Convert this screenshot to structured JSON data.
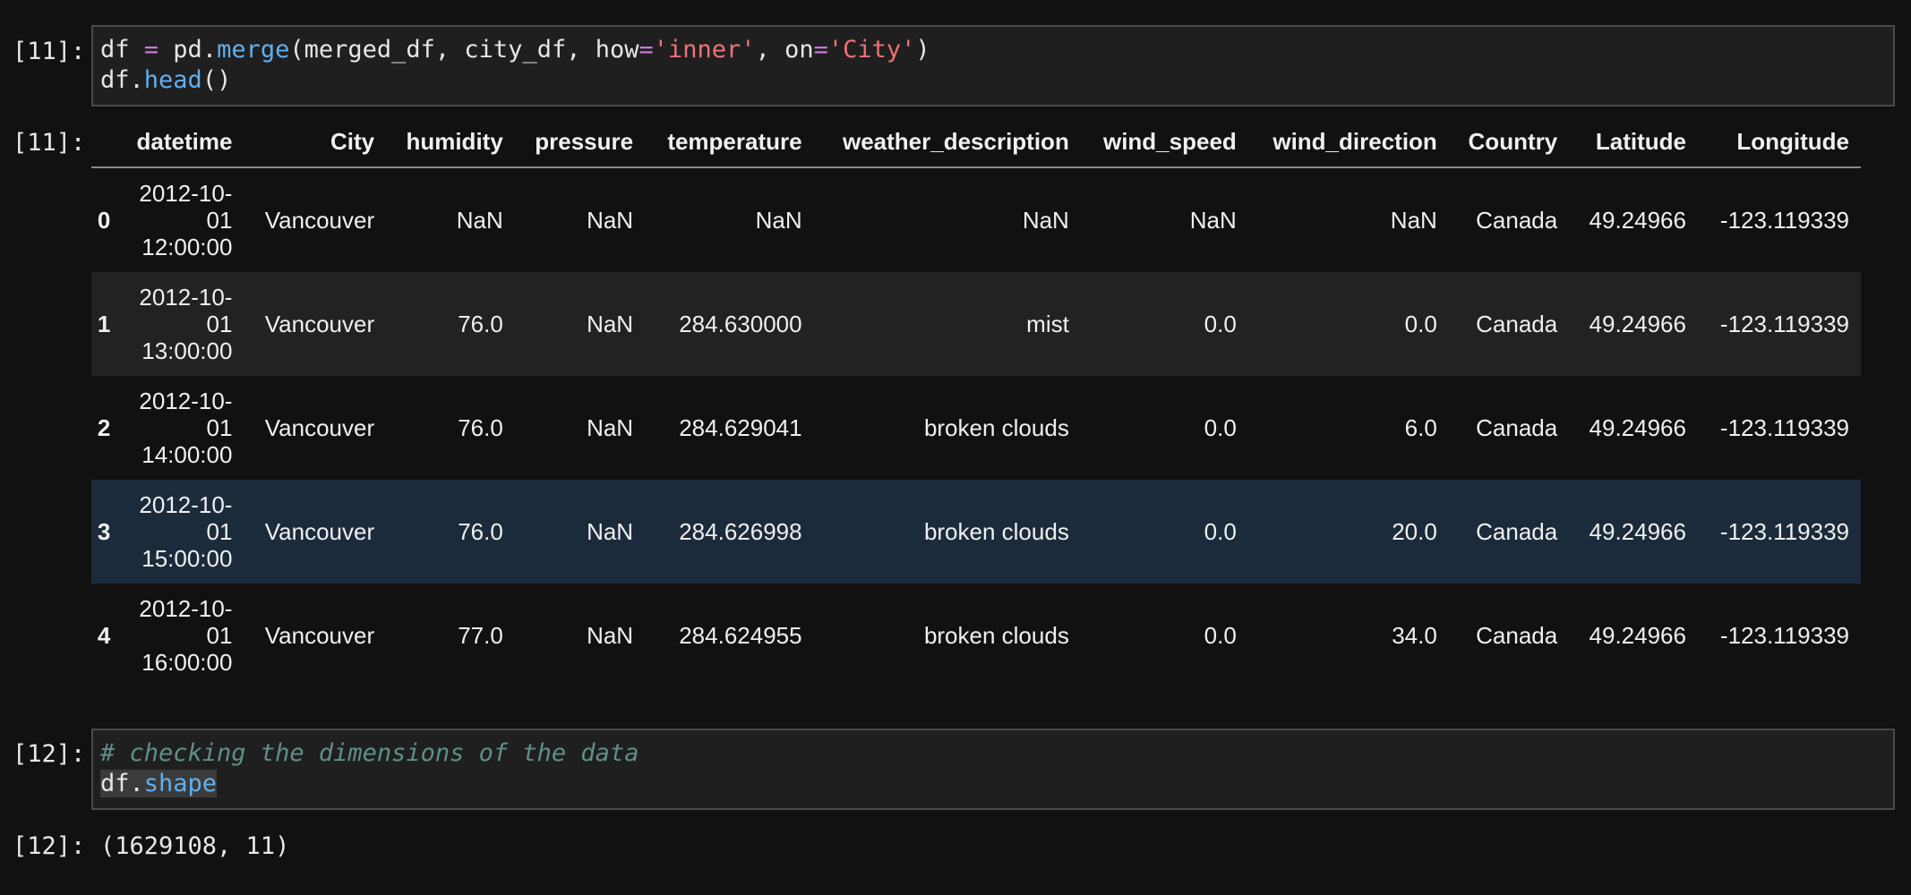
{
  "cell11": {
    "in_prompt": "[11]:",
    "out_prompt": "[11]:",
    "code": {
      "line1": {
        "a": "df ",
        "op1": "=",
        "b": " pd.",
        "fn": "merge",
        "c": "(merged_df, city_df, how",
        "op2": "=",
        "s1": "'inner'",
        "d": ", on",
        "op3": "=",
        "s2": "'City'",
        "e": ")"
      },
      "line2": {
        "a": "df.",
        "fn": "head",
        "b": "()"
      }
    },
    "table": {
      "columns": [
        "",
        "datetime",
        "City",
        "humidity",
        "pressure",
        "temperature",
        "weather_description",
        "wind_speed",
        "wind_direction",
        "Country",
        "Latitude",
        "Longitude"
      ],
      "rows": [
        [
          "0",
          "2012-10-\n01\n12:00:00",
          "Vancouver",
          "NaN",
          "NaN",
          "NaN",
          "NaN",
          "NaN",
          "NaN",
          "Canada",
          "49.24966",
          "-123.119339"
        ],
        [
          "1",
          "2012-10-\n01\n13:00:00",
          "Vancouver",
          "76.0",
          "NaN",
          "284.630000",
          "mist",
          "0.0",
          "0.0",
          "Canada",
          "49.24966",
          "-123.119339"
        ],
        [
          "2",
          "2012-10-\n01\n14:00:00",
          "Vancouver",
          "76.0",
          "NaN",
          "284.629041",
          "broken clouds",
          "0.0",
          "6.0",
          "Canada",
          "49.24966",
          "-123.119339"
        ],
        [
          "3",
          "2012-10-\n01\n15:00:00",
          "Vancouver",
          "76.0",
          "NaN",
          "284.626998",
          "broken clouds",
          "0.0",
          "20.0",
          "Canada",
          "49.24966",
          "-123.119339"
        ],
        [
          "4",
          "2012-10-\n01\n16:00:00",
          "Vancouver",
          "77.0",
          "NaN",
          "284.624955",
          "broken clouds",
          "0.0",
          "34.0",
          "Canada",
          "49.24966",
          "-123.119339"
        ]
      ]
    }
  },
  "cell12": {
    "in_prompt": "[12]:",
    "out_prompt": "[12]:",
    "code": {
      "comment": "# checking the dimensions of the data",
      "line2": {
        "a": "df.",
        "fn": "shape"
      }
    },
    "output": "(1629108, 11)"
  },
  "colors": {
    "background": "#111111",
    "cell_background": "#1f1f1f",
    "row_hover": "#1c2b3b",
    "operator": "#c678dd",
    "function": "#61afef",
    "string": "#f07178",
    "comment": "#5f8f89"
  }
}
